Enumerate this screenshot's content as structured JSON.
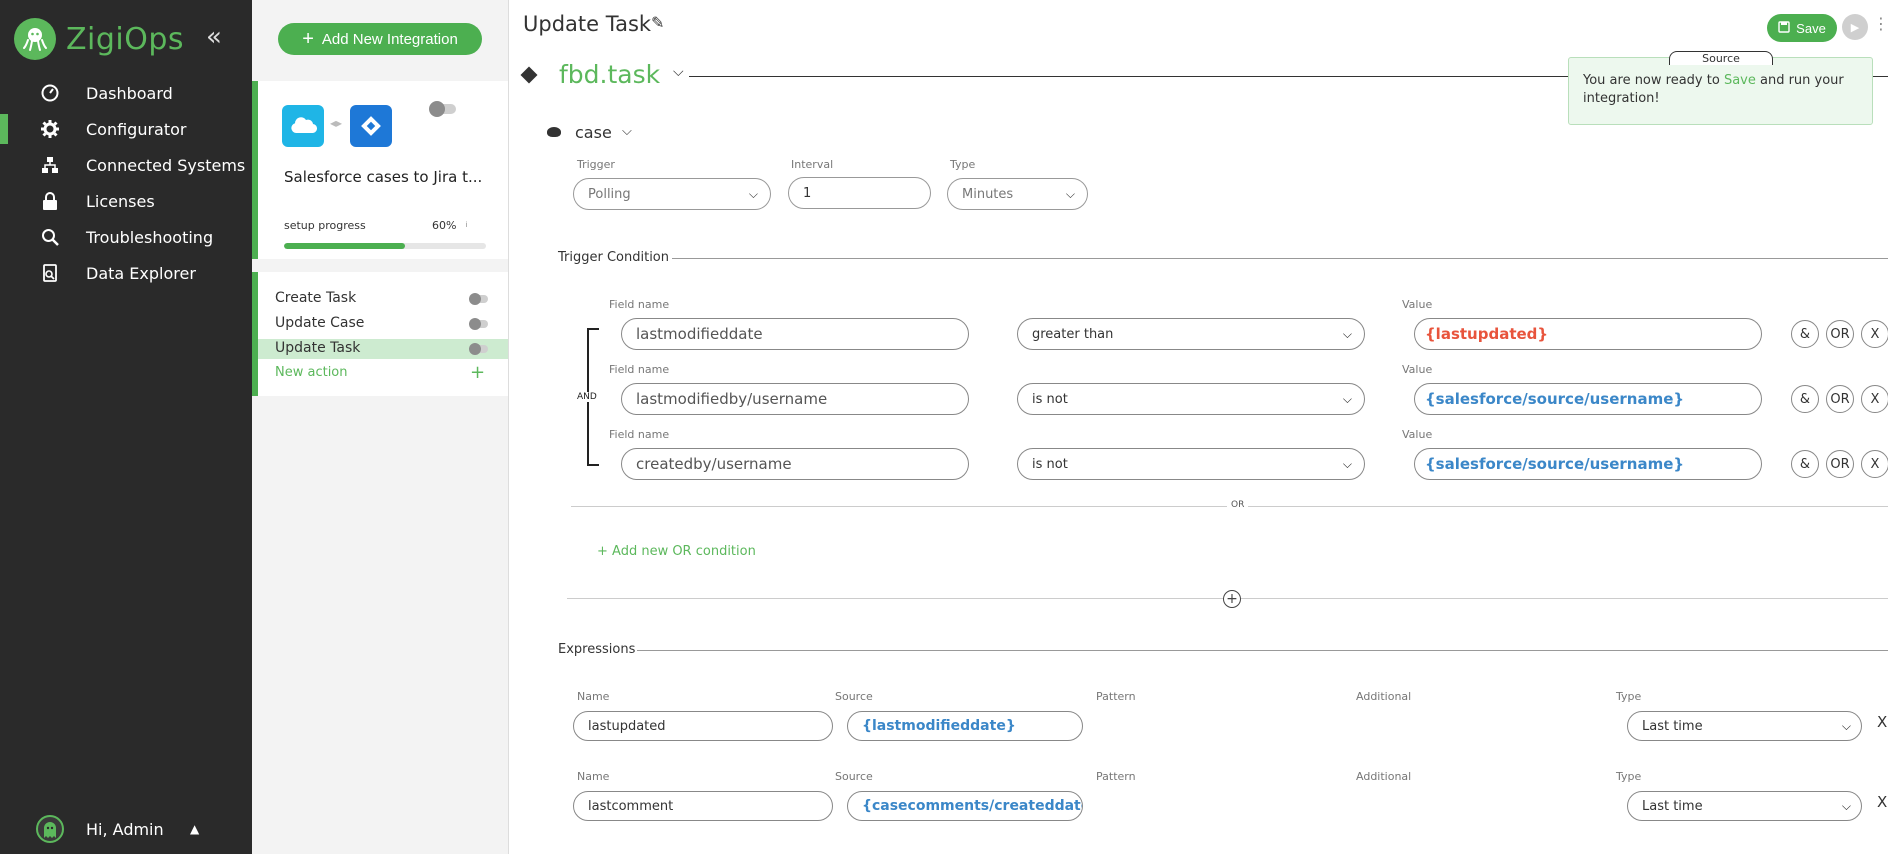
{
  "app": {
    "name": "ZigiOps",
    "accent": "#5cb85c"
  },
  "sidebar": {
    "collapse_icon": "double-chevron-left",
    "items": [
      {
        "label": "Dashboard",
        "icon": "dashboard-icon",
        "active": false
      },
      {
        "label": "Configurator",
        "icon": "gear-icon",
        "active": true
      },
      {
        "label": "Connected Systems",
        "icon": "network-icon",
        "active": false
      },
      {
        "label": "Licenses",
        "icon": "lock-icon",
        "active": false
      },
      {
        "label": "Troubleshooting",
        "icon": "search-icon",
        "active": false
      },
      {
        "label": "Data Explorer",
        "icon": "data-explorer-icon",
        "active": false
      }
    ],
    "user": {
      "greeting": "Hi, Admin"
    }
  },
  "integrations": {
    "add_button": "Add New Integration",
    "card": {
      "name": "Salesforce cases to Jira t...",
      "source_system": "Salesforce",
      "target_system": "Jira",
      "enabled": false,
      "progress_label": "setup progress",
      "progress_value": "60%",
      "progress_fraction": 0.6
    },
    "actions": [
      {
        "label": "Create Task",
        "selected": false
      },
      {
        "label": "Update Case",
        "selected": false
      },
      {
        "label": "Update Task",
        "selected": true
      }
    ],
    "new_action": "New action"
  },
  "header": {
    "title": "Update Task",
    "save_label": "Save"
  },
  "tooltip": {
    "tab": "Source",
    "text_before": "You are now ready to ",
    "text_highlight": "Save",
    "text_after": " and run your integration!"
  },
  "entity": {
    "name": "fbd.task"
  },
  "trigger": {
    "entity": "case",
    "trigger_label": "Trigger",
    "trigger_value": "Polling",
    "interval_label": "Interval",
    "interval_value": "1",
    "type_label": "Type",
    "type_value": "Minutes"
  },
  "trigger_condition": {
    "title": "Trigger Condition",
    "field_label": "Field name",
    "value_label": "Value",
    "join": "AND",
    "rows": [
      {
        "field": "lastmodifieddate",
        "operator": "greater than",
        "value": "{lastupdated}",
        "value_color": "red"
      },
      {
        "field": "lastmodifiedby/username",
        "operator": "is not",
        "value": "{salesforce/source/username}",
        "value_color": "blue"
      },
      {
        "field": "createdby/username",
        "operator": "is not",
        "value": "{salesforce/source/username}",
        "value_color": "blue"
      }
    ],
    "buttons": {
      "and": "&",
      "or": "OR",
      "remove": "X"
    },
    "or_divider": "OR",
    "add_or": "+ Add new OR condition"
  },
  "expressions": {
    "title": "Expressions",
    "labels": {
      "name": "Name",
      "source": "Source",
      "pattern": "Pattern",
      "additional": "Additional",
      "type": "Type"
    },
    "rows": [
      {
        "name": "lastupdated",
        "source": "{lastmodifieddate}",
        "type": "Last time",
        "remove": "X"
      },
      {
        "name": "lastcomment",
        "source": "{casecomments/createddate}",
        "type": "Last time",
        "remove": "X"
      }
    ]
  }
}
